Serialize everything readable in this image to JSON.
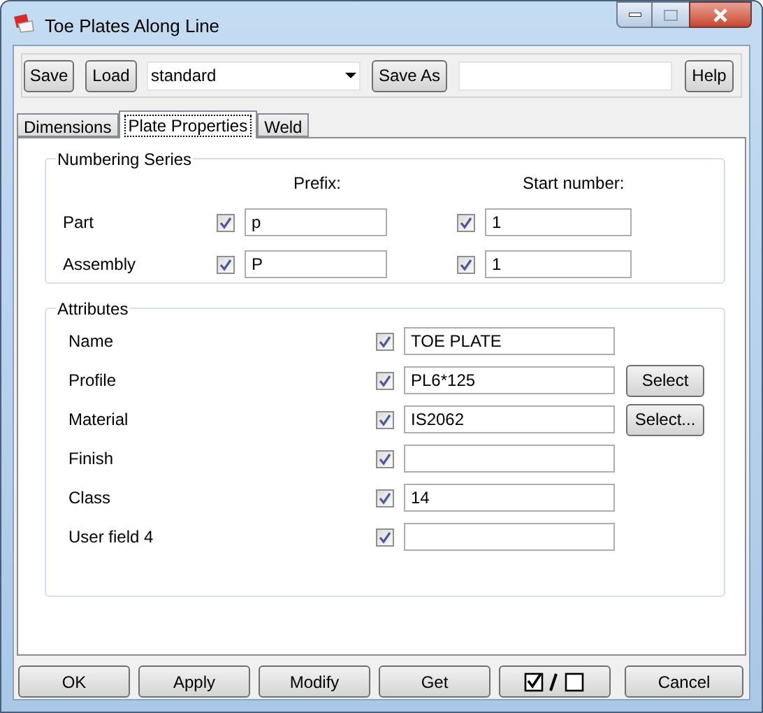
{
  "window": {
    "title": "Toe Plates Along Line"
  },
  "toolbar": {
    "save": "Save",
    "load": "Load",
    "preset": "standard",
    "save_as": "Save As",
    "help": "Help"
  },
  "tabs": [
    {
      "label": "Dimensions",
      "selected": false
    },
    {
      "label": "Plate Properties",
      "selected": true
    },
    {
      "label": "Weld",
      "selected": false
    }
  ],
  "numbering": {
    "title": "Numbering Series",
    "prefix_heading": "Prefix:",
    "start_heading": "Start number:",
    "rows": [
      {
        "label": "Part",
        "prefix_checked": true,
        "prefix": "p",
        "start_checked": true,
        "start": "1"
      },
      {
        "label": "Assembly",
        "prefix_checked": true,
        "prefix": "P",
        "start_checked": true,
        "start": "1"
      }
    ]
  },
  "attributes": {
    "title": "Attributes",
    "rows": [
      {
        "label": "Name",
        "checked": true,
        "value": "TOE PLATE"
      },
      {
        "label": "Profile",
        "checked": true,
        "value": "PL6*125",
        "button": "Select"
      },
      {
        "label": "Material",
        "checked": true,
        "value": "IS2062",
        "button": "Select..."
      },
      {
        "label": "Finish",
        "checked": true
      },
      {
        "label": "Class",
        "checked": true,
        "value": "14"
      },
      {
        "label": "User field 4",
        "checked": true
      }
    ]
  },
  "footer_buttons": [
    {
      "kind": "text",
      "label": "OK"
    },
    {
      "kind": "text",
      "label": "Apply"
    },
    {
      "kind": "text",
      "label": "Modify"
    },
    {
      "kind": "text",
      "label": "Get"
    },
    {
      "kind": "toggle-all"
    },
    {
      "kind": "text",
      "label": "Cancel"
    }
  ]
}
